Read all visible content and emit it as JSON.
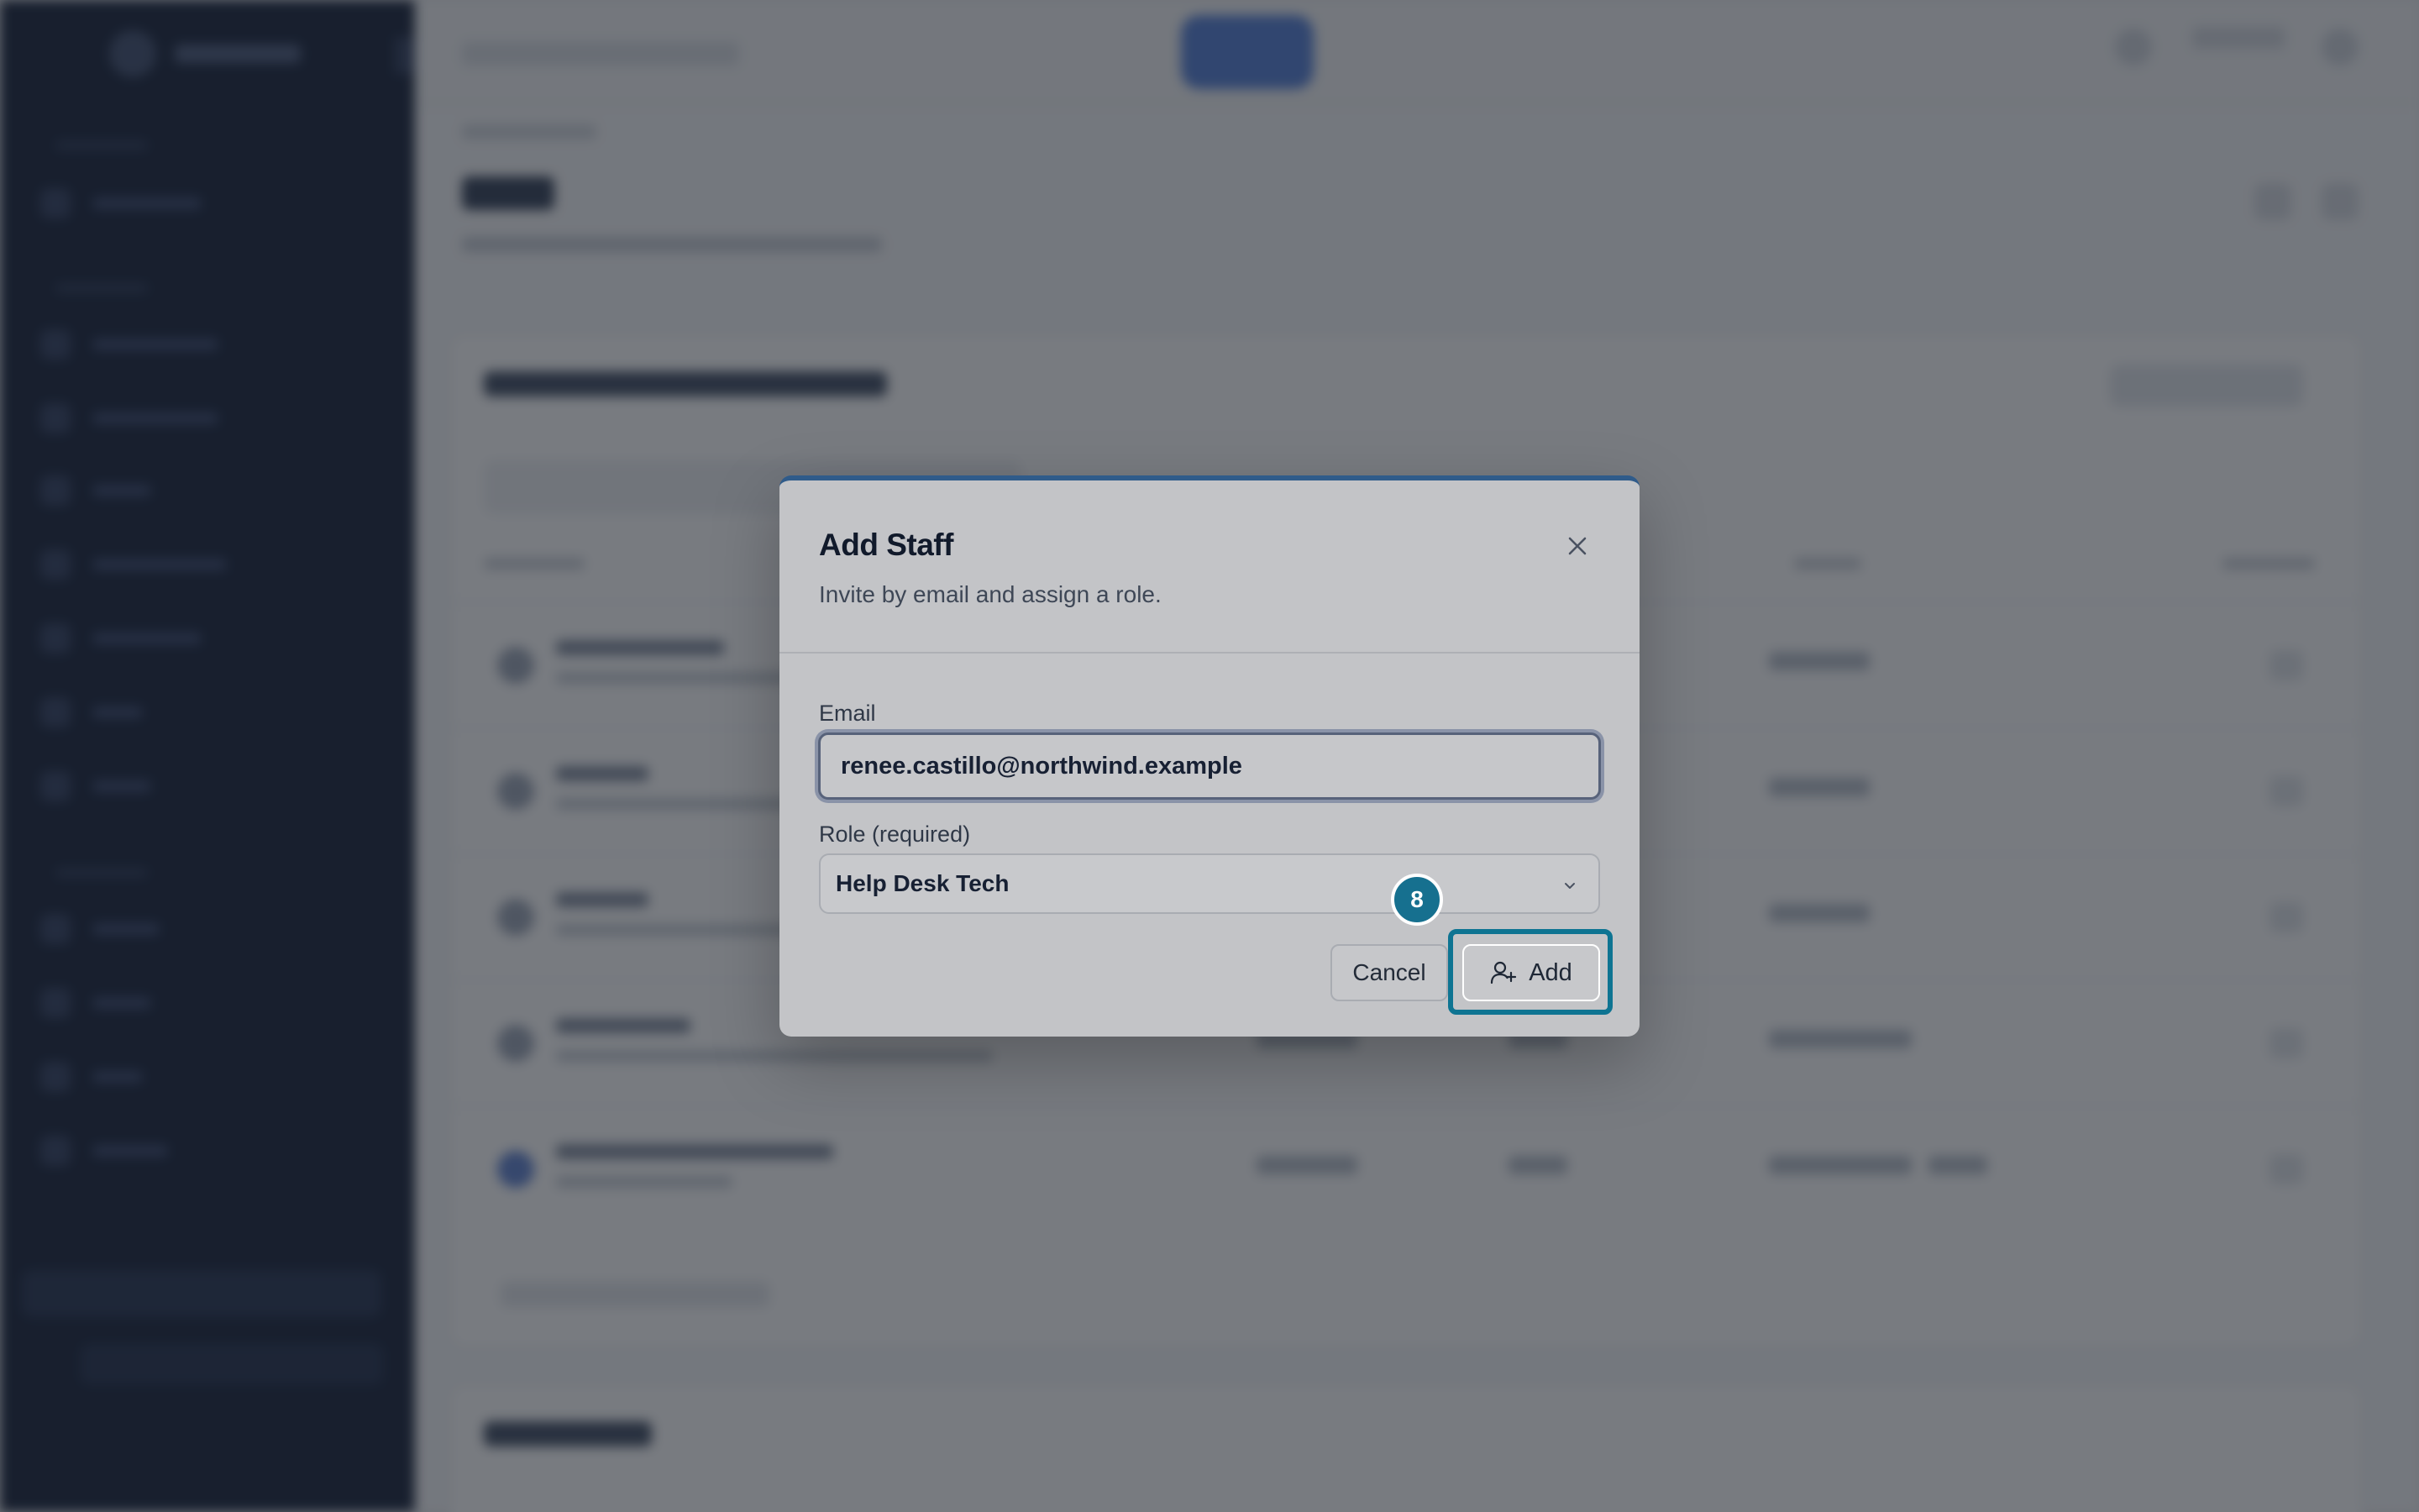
{
  "modal": {
    "title": "Add Staff",
    "subtitle": "Invite by email and assign a role.",
    "email_label": "Email",
    "email_value": "renee.castillo@northwind.example",
    "role_label": "Role (required)",
    "role_value": "Help Desk Tech",
    "cancel_label": "Cancel",
    "add_label": "Add",
    "step_badge": "8",
    "accent_color": "#0e7492"
  },
  "icons": {
    "close": "close-icon",
    "chevron": "chevron-down-icon",
    "add_user": "user-plus-icon"
  }
}
